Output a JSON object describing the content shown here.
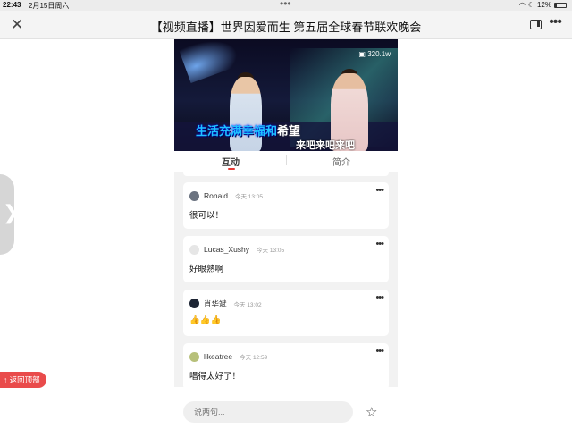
{
  "status_bar": {
    "time": "22:43",
    "date": "2月15日周六",
    "battery": "12%"
  },
  "nav": {
    "title": "【视频直播】世界因爱而生 第五届全球春节联欢晚会"
  },
  "video": {
    "view_count": "320.1w",
    "lyric_highlight": "生活充满幸福和",
    "lyric_rest": "希望",
    "lyric_line2": "来吧来吧来吧"
  },
  "tabs": [
    {
      "label": "互动",
      "active": true
    },
    {
      "label": "简介",
      "active": false
    }
  ],
  "comments": [
    {
      "user": "Ronald",
      "time": "今天 13:05",
      "text": "很可以！"
    },
    {
      "user": "Lucas_Xushy",
      "time": "今天 13:05",
      "text": "好眼熟啊"
    },
    {
      "user": "肖华斌",
      "time": "今天 13:02",
      "text": "👍👍👍"
    },
    {
      "user": "likeatree",
      "time": "今天 12:59",
      "text": "唱得太好了！"
    }
  ],
  "input": {
    "placeholder": "说两句..."
  },
  "back_to_top": {
    "label": "返回顶部"
  },
  "colors": {
    "accent": "#e53935",
    "lyric": "#1ec2ff"
  }
}
